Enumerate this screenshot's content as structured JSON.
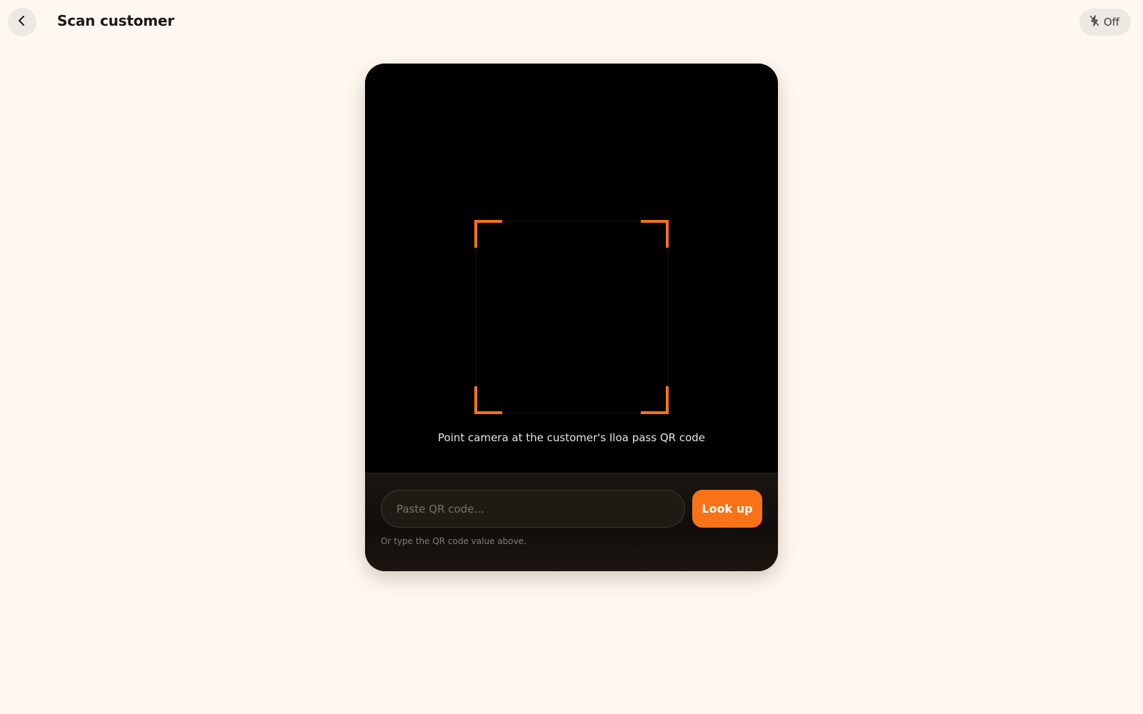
{
  "header": {
    "title": "Scan customer",
    "back_icon": "chevron-left-icon"
  },
  "flash": {
    "icon": "flash-off-icon",
    "label": "Off"
  },
  "scanner": {
    "hint": "Point camera at the customer's Iloa pass QR code",
    "frame_color": "#f97316"
  },
  "manual_entry": {
    "placeholder": "Paste QR code...",
    "value": "",
    "button_label": "Look up",
    "helper_text": "Or type the QR code value above."
  },
  "colors": {
    "accent": "#f97316",
    "background": "#fff8f2",
    "card": "#000000"
  }
}
